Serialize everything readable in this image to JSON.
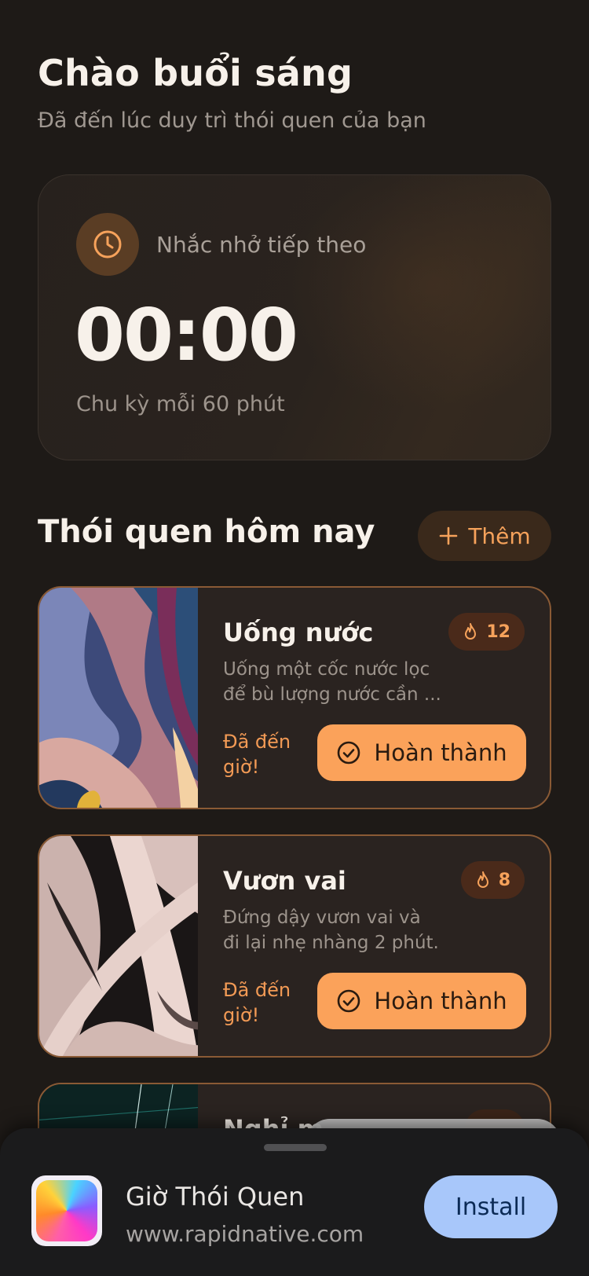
{
  "header": {
    "greeting": "Chào buổi sáng",
    "subtitle": "Đã đến lúc duy trì thói quen của bạn"
  },
  "reminder": {
    "icon": "clock-icon",
    "label": "Nhắc nhở tiếp theo",
    "time": "00:00",
    "cycle": "Chu kỳ mỗi 60 phút"
  },
  "habits_section": {
    "title": "Thói quen hôm nay",
    "add_label": "Thêm"
  },
  "habits": [
    {
      "title": "Uống nước",
      "streak": "12",
      "description": "Uống một cốc nước lọc để bù lượng nước cần ...",
      "status": "Đã đến giờ!",
      "button": "Hoàn thành"
    },
    {
      "title": "Vươn vai",
      "streak": "8",
      "description": "Đứng dậy vươn vai và đi lại nhẹ nhàng 2 phút.",
      "status": "Đã đến giờ!",
      "button": "Hoàn thành"
    },
    {
      "title": "Nghỉ m"
    }
  ],
  "install_sheet": {
    "app_name": "Giờ Thói Quen",
    "url": "www.rapidnative.com",
    "install_label": "Install"
  },
  "colors": {
    "background": "#1e1a17",
    "accent": "#fba25a",
    "install_button": "#a8c7fa"
  }
}
